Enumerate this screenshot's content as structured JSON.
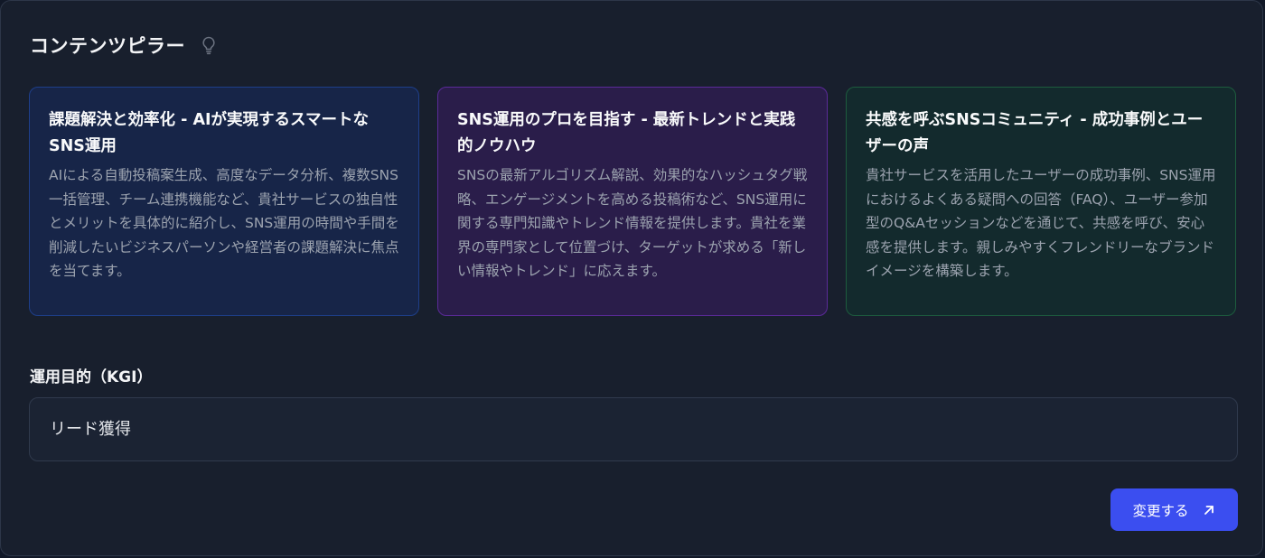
{
  "panel": {
    "title": "コンテンツピラー",
    "title_icon": "lightbulb-icon"
  },
  "pillars": [
    {
      "title": "課題解決と効率化 - AIが実現するスマートなSNS運用",
      "description": "AIによる自動投稿案生成、高度なデータ分析、複数SNS一括管理、チーム連携機能など、貴社サービスの独自性とメリットを具体的に紹介し、SNS運用の時間や手間を削減したいビジネスパーソンや経営者の課題解決に焦点を当てます。",
      "accent": "#1e3f8a"
    },
    {
      "title": "SNS運用のプロを目指す - 最新トレンドと実践的ノウハウ",
      "description": "SNSの最新アルゴリズム解説、効果的なハッシュタグ戦略、エンゲージメントを高める投稿術など、SNS運用に関する専門知識やトレンド情報を提供します。貴社を業界の専門家として位置づけ、ターゲットが求める「新しい情報やトレンド」に応えます。",
      "accent": "#5b2a99"
    },
    {
      "title": "共感を呼ぶSNSコミュニティ - 成功事例とユーザーの声",
      "description": "貴社サービスを活用したユーザーの成功事例、SNS運用におけるよくある疑問への回答（FAQ）、ユーザー参加型のQ&Aセッションなどを通じて、共感を呼び、安心感を提供します。親しみやすくフレンドリーなブランドイメージを構築します。",
      "accent": "#1d5c3e"
    }
  ],
  "kgi": {
    "label": "運用目的（KGI）",
    "value": "リード獲得"
  },
  "actions": {
    "change_label": "変更する",
    "change_icon": "arrow-up-right-icon",
    "accent": "#3b4ef0"
  }
}
